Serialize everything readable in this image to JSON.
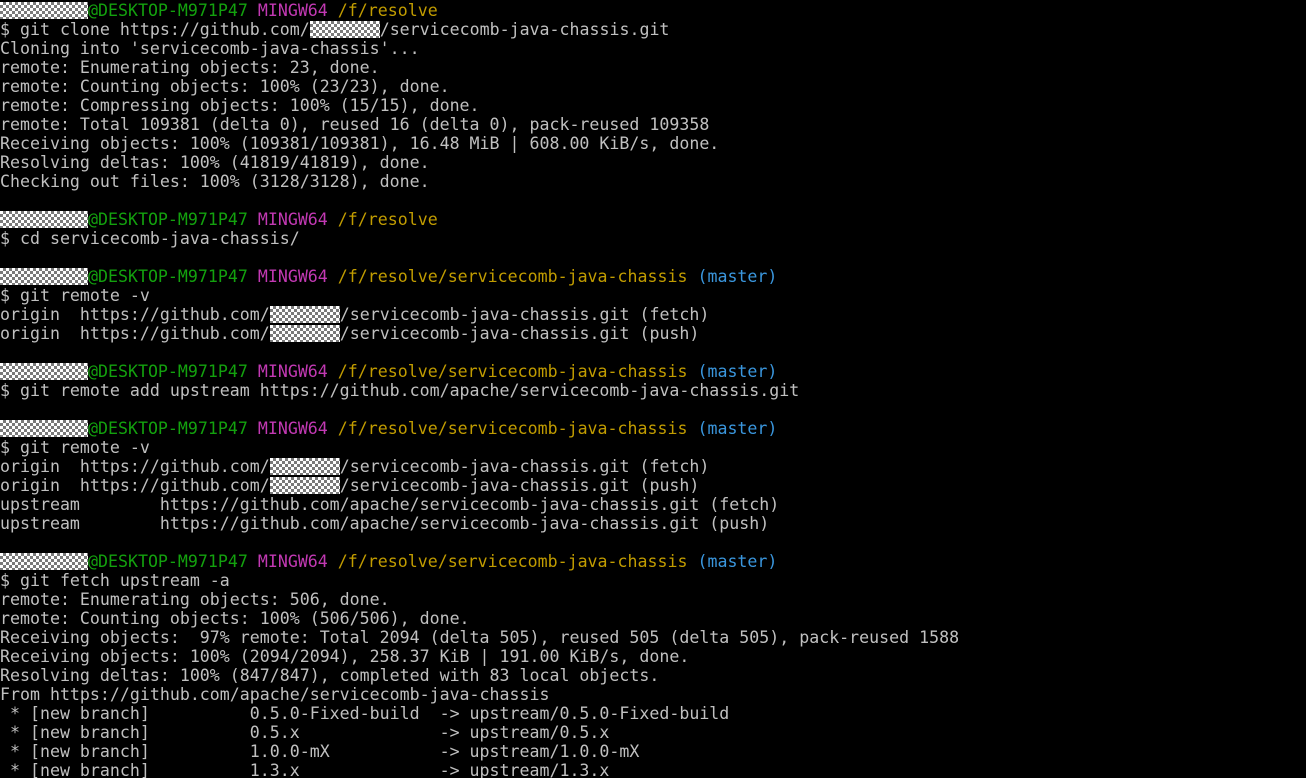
{
  "colors": {
    "background": "#000000",
    "text": "#c0c0c0",
    "host": "#13a10e",
    "system": "#c239b3",
    "path": "#c19c00",
    "branch": "#3a96dd"
  },
  "prompts": [
    {
      "host": "@DESKTOP-M971P47",
      "system": "MINGW64",
      "path": "/f/resolve",
      "branch": ""
    },
    {
      "host": "@DESKTOP-M971P47",
      "system": "MINGW64",
      "path": "/f/resolve",
      "branch": ""
    },
    {
      "host": "@DESKTOP-M971P47",
      "system": "MINGW64",
      "path": "/f/resolve/servicecomb-java-chassis",
      "branch": "(master)"
    },
    {
      "host": "@DESKTOP-M971P47",
      "system": "MINGW64",
      "path": "/f/resolve/servicecomb-java-chassis",
      "branch": "(master)"
    },
    {
      "host": "@DESKTOP-M971P47",
      "system": "MINGW64",
      "path": "/f/resolve/servicecomb-java-chassis",
      "branch": "(master)"
    },
    {
      "host": "@DESKTOP-M971P47",
      "system": "MINGW64",
      "path": "/f/resolve/servicecomb-java-chassis",
      "branch": "(master)"
    }
  ],
  "commands": [
    {
      "prefix": "$ git clone https://github.com/",
      "suffix": "/servicecomb-java-chassis.git"
    },
    {
      "text": "$ cd servicecomb-java-chassis/"
    },
    {
      "text": "$ git remote -v"
    },
    {
      "text": "$ git remote add upstream https://github.com/apache/servicecomb-java-chassis.git"
    },
    {
      "text": "$ git remote -v"
    },
    {
      "text": "$ git fetch upstream -a"
    }
  ],
  "clone_output": [
    "Cloning into 'servicecomb-java-chassis'...",
    "remote: Enumerating objects: 23, done.",
    "remote: Counting objects: 100% (23/23), done.",
    "remote: Compressing objects: 100% (15/15), done.",
    "remote: Total 109381 (delta 0), reused 16 (delta 0), pack-reused 109358",
    "Receiving objects: 100% (109381/109381), 16.48 MiB | 608.00 KiB/s, done.",
    "Resolving deltas: 100% (41819/41819), done.",
    "Checking out files: 100% (3128/3128), done."
  ],
  "remotes_first": [
    {
      "prefix": "origin  https://github.com/",
      "suffix": "/servicecomb-java-chassis.git (fetch)"
    },
    {
      "prefix": "origin  https://github.com/",
      "suffix": "/servicecomb-java-chassis.git (push)"
    }
  ],
  "remotes_second": [
    {
      "prefix": "origin  https://github.com/",
      "suffix": "/servicecomb-java-chassis.git (fetch)"
    },
    {
      "prefix": "origin  https://github.com/",
      "suffix": "/servicecomb-java-chassis.git (push)"
    }
  ],
  "upstream_lines": [
    "upstream        https://github.com/apache/servicecomb-java-chassis.git (fetch)",
    "upstream        https://github.com/apache/servicecomb-java-chassis.git (push)"
  ],
  "fetch_output": [
    "remote: Enumerating objects: 506, done.",
    "remote: Counting objects: 100% (506/506), done.",
    "Receiving objects:  97% remote: Total 2094 (delta 505), reused 505 (delta 505), pack-reused 1588",
    "Receiving objects: 100% (2094/2094), 258.37 KiB | 191.00 KiB/s, done.",
    "Resolving deltas: 100% (847/847), completed with 83 local objects.",
    "From https://github.com/apache/servicecomb-java-chassis",
    " * [new branch]          0.5.0-Fixed-build  -> upstream/0.5.0-Fixed-build",
    " * [new branch]          0.5.x              -> upstream/0.5.x",
    " * [new branch]          1.0.0-mX           -> upstream/1.0.0-mX",
    " * [new branch]          1.3.x              -> upstream/1.3.x"
  ]
}
